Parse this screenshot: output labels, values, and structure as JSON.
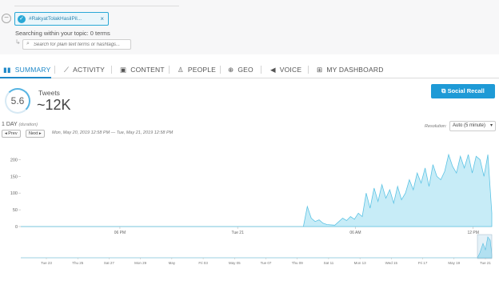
{
  "topic": {
    "tag_label": "#RakyatTolakHasilPil...",
    "searching_text": "Searching within your topic: 0 terms",
    "search_placeholder": "Search for plain text terms or hashtags..."
  },
  "tabs": [
    {
      "label": "SUMMARY",
      "icon": "bar-chart-icon"
    },
    {
      "label": "ACTIVITY",
      "icon": "line-chart-icon"
    },
    {
      "label": "CONTENT",
      "icon": "image-icon"
    },
    {
      "label": "PEOPLE",
      "icon": "person-icon"
    },
    {
      "label": "GEO",
      "icon": "globe-icon"
    },
    {
      "label": "VOICE",
      "icon": "megaphone-icon"
    },
    {
      "label": "MY DASHBOARD",
      "icon": "grid-icon"
    }
  ],
  "summary": {
    "score": "5.6",
    "tweets_label": "Tweets",
    "tweets_count": "~12K"
  },
  "social_recall_label": "Social Recall",
  "duration": {
    "value": "1 DAY",
    "hint": "(duration)",
    "prev_label": "◂ Prev",
    "next_label": "Next ▸",
    "range_text": "Mon, May 20, 2019 12:58 PM — Tue, May 21, 2019 12:58 PM"
  },
  "resolution": {
    "label": "Resolution:",
    "value": "Auto (5 minute)"
  },
  "colors": {
    "accent": "#1e88c8",
    "button": "#1e9ad6",
    "area_fill": "#c7ecf7",
    "area_line": "#5cc3e4"
  },
  "chart_data": {
    "type": "area",
    "y_ticks": [
      "200",
      "150",
      "100",
      "50",
      "0"
    ],
    "ylim": [
      0,
      220
    ],
    "x_ticks": [
      "06 PM",
      "Tue 21",
      "06 AM",
      "12 PM"
    ],
    "xlim": [
      0,
      24
    ],
    "grid": false,
    "legend": "none",
    "x": [
      0,
      14.4,
      14.6,
      14.8,
      15.0,
      15.2,
      15.4,
      15.6,
      16.0,
      16.4,
      16.6,
      16.8,
      17.0,
      17.2,
      17.4,
      17.6,
      17.8,
      18.0,
      18.2,
      18.4,
      18.6,
      18.8,
      19.0,
      19.2,
      19.4,
      19.6,
      19.8,
      20.0,
      20.2,
      20.4,
      20.6,
      20.8,
      21.0,
      21.2,
      21.4,
      21.6,
      21.8,
      22.0,
      22.2,
      22.4,
      22.6,
      22.8,
      23.0,
      23.2,
      23.4,
      23.6,
      23.8,
      24.0
    ],
    "y": [
      0,
      0,
      60,
      25,
      15,
      20,
      10,
      6,
      4,
      25,
      18,
      30,
      22,
      40,
      30,
      100,
      55,
      115,
      75,
      125,
      85,
      110,
      70,
      120,
      80,
      100,
      140,
      110,
      160,
      130,
      175,
      120,
      185,
      150,
      140,
      165,
      215,
      180,
      160,
      210,
      175,
      215,
      160,
      210,
      200,
      150,
      215,
      40
    ],
    "overview_ticks": [
      "Tue 23",
      "Thu 25",
      "Sat 27",
      "Mon 29",
      "May",
      "Fri 03",
      "May 05",
      "Tue 07",
      "Thu 09",
      "Sat 11",
      "Mon 13",
      "Wed 15",
      "Fri 17",
      "May 19",
      "Tue 21"
    ]
  }
}
